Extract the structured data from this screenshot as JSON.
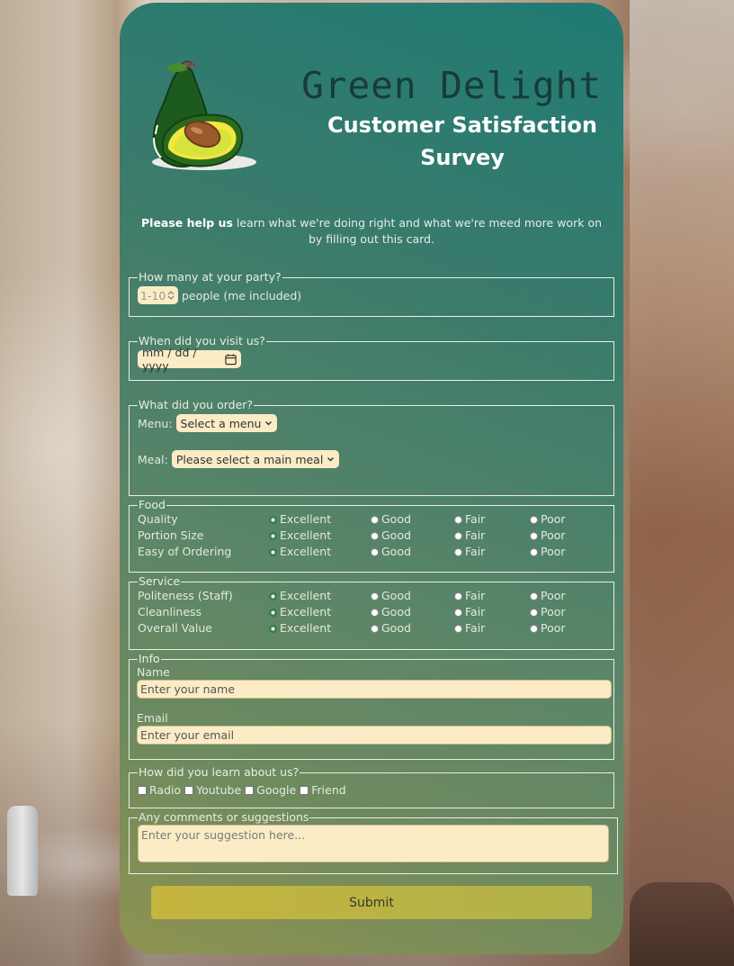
{
  "header": {
    "brand": "Green Delight",
    "subtitle": "Customer Satisfaction Survey",
    "intro_bold": "Please help us",
    "intro_rest": " learn what we're doing right and what we're meed more work on by filling out this card."
  },
  "party": {
    "legend": "How many at your party?",
    "placeholder": "1-10",
    "suffix": "people (me included)"
  },
  "visit": {
    "legend": "When did you visit us?",
    "placeholder": "mm / dd / yyyy"
  },
  "order": {
    "legend": "What did you order?",
    "menu_label": "Menu:",
    "menu_value": "Select a menu",
    "meal_label": "Meal:",
    "meal_value": "Please select a main meal"
  },
  "options": [
    "Excellent",
    "Good",
    "Fair",
    "Poor"
  ],
  "food": {
    "legend": "Food",
    "rows": [
      {
        "label": "Quality",
        "selected": "Excellent"
      },
      {
        "label": "Portion Size",
        "selected": "Excellent"
      },
      {
        "label": "Easy of Ordering",
        "selected": "Excellent"
      }
    ]
  },
  "service": {
    "legend": "Service",
    "rows": [
      {
        "label": "Politeness (Staff)",
        "selected": "Excellent"
      },
      {
        "label": "Cleanliness",
        "selected": "Excellent"
      },
      {
        "label": "Overall Value",
        "selected": "Excellent"
      }
    ]
  },
  "info": {
    "legend": "Info",
    "name_label": "Name",
    "name_placeholder": "Enter your name",
    "email_label": "Email",
    "email_placeholder": "Enter your email"
  },
  "learn": {
    "legend": "How did you learn about us?",
    "choices": [
      "Radio",
      "Youtube",
      "Google",
      "Friend"
    ]
  },
  "comments": {
    "legend": "Any comments or suggestions",
    "placeholder": "Enter your suggestion here..."
  },
  "submit_label": "Submit",
  "colors": {
    "card_top": "#1f7b74",
    "card_bottom": "#8f9350",
    "input_bg": "#fbecc5",
    "submit_bg": "#c5b43e",
    "radio_selected": "#2c7a3e"
  },
  "icons": {
    "logo": "avocado-logo",
    "date": "calendar-icon",
    "select": "chevron-down-icon",
    "spinner": "spinner-arrows-icon"
  }
}
